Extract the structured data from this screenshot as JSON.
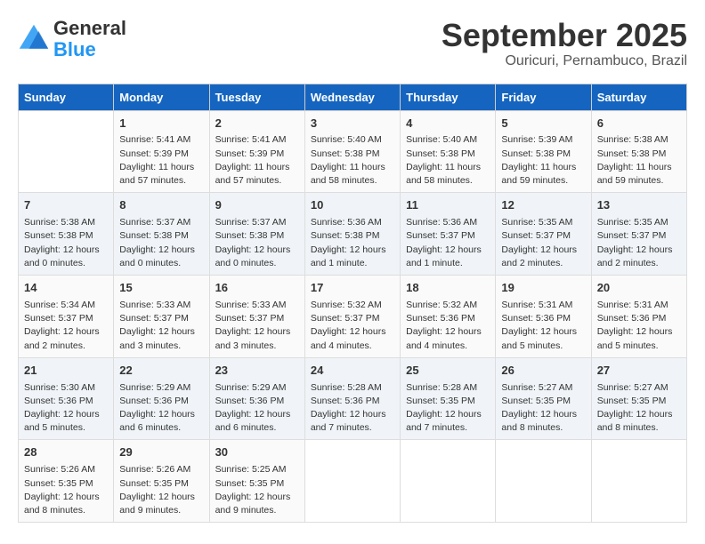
{
  "header": {
    "logo_line1": "General",
    "logo_line2": "Blue",
    "month": "September 2025",
    "location": "Ouricuri, Pernambuco, Brazil"
  },
  "days_of_week": [
    "Sunday",
    "Monday",
    "Tuesday",
    "Wednesday",
    "Thursday",
    "Friday",
    "Saturday"
  ],
  "weeks": [
    [
      {
        "day": "",
        "content": ""
      },
      {
        "day": "1",
        "content": "Sunrise: 5:41 AM\nSunset: 5:39 PM\nDaylight: 11 hours\nand 57 minutes."
      },
      {
        "day": "2",
        "content": "Sunrise: 5:41 AM\nSunset: 5:39 PM\nDaylight: 11 hours\nand 57 minutes."
      },
      {
        "day": "3",
        "content": "Sunrise: 5:40 AM\nSunset: 5:38 PM\nDaylight: 11 hours\nand 58 minutes."
      },
      {
        "day": "4",
        "content": "Sunrise: 5:40 AM\nSunset: 5:38 PM\nDaylight: 11 hours\nand 58 minutes."
      },
      {
        "day": "5",
        "content": "Sunrise: 5:39 AM\nSunset: 5:38 PM\nDaylight: 11 hours\nand 59 minutes."
      },
      {
        "day": "6",
        "content": "Sunrise: 5:38 AM\nSunset: 5:38 PM\nDaylight: 11 hours\nand 59 minutes."
      }
    ],
    [
      {
        "day": "7",
        "content": "Sunrise: 5:38 AM\nSunset: 5:38 PM\nDaylight: 12 hours\nand 0 minutes."
      },
      {
        "day": "8",
        "content": "Sunrise: 5:37 AM\nSunset: 5:38 PM\nDaylight: 12 hours\nand 0 minutes."
      },
      {
        "day": "9",
        "content": "Sunrise: 5:37 AM\nSunset: 5:38 PM\nDaylight: 12 hours\nand 0 minutes."
      },
      {
        "day": "10",
        "content": "Sunrise: 5:36 AM\nSunset: 5:38 PM\nDaylight: 12 hours\nand 1 minute."
      },
      {
        "day": "11",
        "content": "Sunrise: 5:36 AM\nSunset: 5:37 PM\nDaylight: 12 hours\nand 1 minute."
      },
      {
        "day": "12",
        "content": "Sunrise: 5:35 AM\nSunset: 5:37 PM\nDaylight: 12 hours\nand 2 minutes."
      },
      {
        "day": "13",
        "content": "Sunrise: 5:35 AM\nSunset: 5:37 PM\nDaylight: 12 hours\nand 2 minutes."
      }
    ],
    [
      {
        "day": "14",
        "content": "Sunrise: 5:34 AM\nSunset: 5:37 PM\nDaylight: 12 hours\nand 2 minutes."
      },
      {
        "day": "15",
        "content": "Sunrise: 5:33 AM\nSunset: 5:37 PM\nDaylight: 12 hours\nand 3 minutes."
      },
      {
        "day": "16",
        "content": "Sunrise: 5:33 AM\nSunset: 5:37 PM\nDaylight: 12 hours\nand 3 minutes."
      },
      {
        "day": "17",
        "content": "Sunrise: 5:32 AM\nSunset: 5:37 PM\nDaylight: 12 hours\nand 4 minutes."
      },
      {
        "day": "18",
        "content": "Sunrise: 5:32 AM\nSunset: 5:36 PM\nDaylight: 12 hours\nand 4 minutes."
      },
      {
        "day": "19",
        "content": "Sunrise: 5:31 AM\nSunset: 5:36 PM\nDaylight: 12 hours\nand 5 minutes."
      },
      {
        "day": "20",
        "content": "Sunrise: 5:31 AM\nSunset: 5:36 PM\nDaylight: 12 hours\nand 5 minutes."
      }
    ],
    [
      {
        "day": "21",
        "content": "Sunrise: 5:30 AM\nSunset: 5:36 PM\nDaylight: 12 hours\nand 5 minutes."
      },
      {
        "day": "22",
        "content": "Sunrise: 5:29 AM\nSunset: 5:36 PM\nDaylight: 12 hours\nand 6 minutes."
      },
      {
        "day": "23",
        "content": "Sunrise: 5:29 AM\nSunset: 5:36 PM\nDaylight: 12 hours\nand 6 minutes."
      },
      {
        "day": "24",
        "content": "Sunrise: 5:28 AM\nSunset: 5:36 PM\nDaylight: 12 hours\nand 7 minutes."
      },
      {
        "day": "25",
        "content": "Sunrise: 5:28 AM\nSunset: 5:35 PM\nDaylight: 12 hours\nand 7 minutes."
      },
      {
        "day": "26",
        "content": "Sunrise: 5:27 AM\nSunset: 5:35 PM\nDaylight: 12 hours\nand 8 minutes."
      },
      {
        "day": "27",
        "content": "Sunrise: 5:27 AM\nSunset: 5:35 PM\nDaylight: 12 hours\nand 8 minutes."
      }
    ],
    [
      {
        "day": "28",
        "content": "Sunrise: 5:26 AM\nSunset: 5:35 PM\nDaylight: 12 hours\nand 8 minutes."
      },
      {
        "day": "29",
        "content": "Sunrise: 5:26 AM\nSunset: 5:35 PM\nDaylight: 12 hours\nand 9 minutes."
      },
      {
        "day": "30",
        "content": "Sunrise: 5:25 AM\nSunset: 5:35 PM\nDaylight: 12 hours\nand 9 minutes."
      },
      {
        "day": "",
        "content": ""
      },
      {
        "day": "",
        "content": ""
      },
      {
        "day": "",
        "content": ""
      },
      {
        "day": "",
        "content": ""
      }
    ]
  ]
}
